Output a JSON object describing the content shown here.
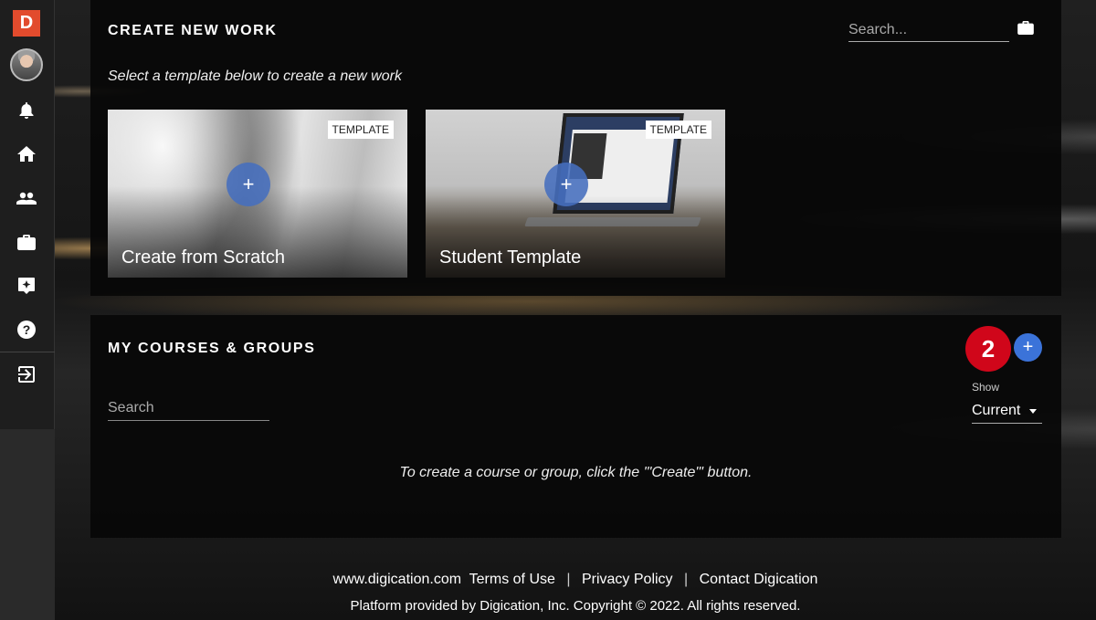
{
  "sidebar": {
    "logo": "D",
    "items": [
      {
        "name": "notifications",
        "icon": "bell-icon"
      },
      {
        "name": "home",
        "icon": "home-icon"
      },
      {
        "name": "people",
        "icon": "people-icon"
      },
      {
        "name": "portfolio",
        "icon": "briefcase-icon"
      },
      {
        "name": "feedback",
        "icon": "sparkle-note-icon"
      },
      {
        "name": "help",
        "icon": "help-icon"
      },
      {
        "name": "logout",
        "icon": "exit-icon"
      }
    ]
  },
  "create_work": {
    "title": "CREATE NEW WORK",
    "subtitle": "Select a template below to create a new work",
    "search_placeholder": "Search...",
    "templates": [
      {
        "label": "Create from Scratch",
        "badge": "TEMPLATE",
        "button": "+"
      },
      {
        "label": "Student Template",
        "badge": "TEMPLATE",
        "button": "+"
      }
    ]
  },
  "courses": {
    "title": "MY COURSES & GROUPS",
    "search_placeholder": "Search",
    "step_number": "2",
    "add_button": "+",
    "show_label": "Show",
    "show_value": "Current",
    "empty_message": "To create a course or group, click the '\"Create\"' button."
  },
  "footer": {
    "links": [
      "www.digication.com",
      "Terms of Use",
      "Privacy Policy",
      "Contact Digication"
    ],
    "separator": "|",
    "copyright": "Platform provided by Digication, Inc. Copyright © 2022. All rights reserved."
  },
  "colors": {
    "logo": "#e24b2d",
    "primary_blue": "#3b73d9",
    "step_red": "#d0061a"
  }
}
